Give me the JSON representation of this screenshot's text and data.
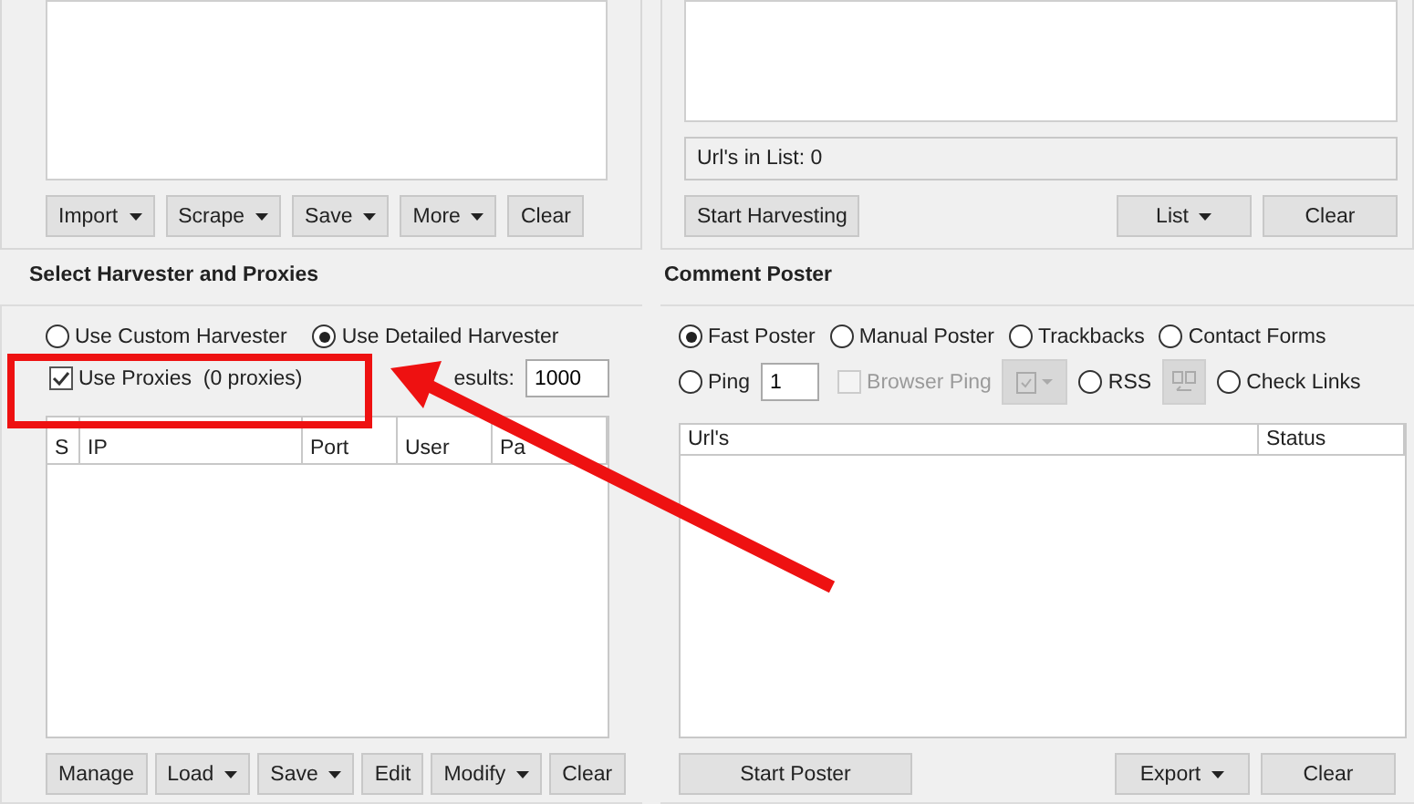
{
  "top_left": {
    "buttons": [
      {
        "label": "Import",
        "dropdown": true
      },
      {
        "label": "Scrape",
        "dropdown": true
      },
      {
        "label": "Save",
        "dropdown": true
      },
      {
        "label": "More",
        "dropdown": true
      },
      {
        "label": "Clear",
        "dropdown": false
      }
    ]
  },
  "top_right": {
    "status": "Url's in List: 0",
    "start_button": "Start Harvesting",
    "buttons": [
      {
        "label": "List",
        "dropdown": true
      },
      {
        "label": "Clear",
        "dropdown": false
      }
    ]
  },
  "harvester": {
    "title": "Select Harvester and Proxies",
    "options": [
      {
        "label": "Use Custom Harvester",
        "selected": false
      },
      {
        "label": "Use Detailed Harvester",
        "selected": true
      }
    ],
    "use_proxies": {
      "label": "Use Proxies  (0 proxies)",
      "checked": true
    },
    "results_label": "esults:",
    "results_value": "1000",
    "columns": [
      "S",
      "IP",
      "Port",
      "User",
      "Pa"
    ],
    "buttons": [
      {
        "label": "Manage",
        "dropdown": false
      },
      {
        "label": "Load",
        "dropdown": true
      },
      {
        "label": "Save",
        "dropdown": true
      },
      {
        "label": "Edit",
        "dropdown": false
      },
      {
        "label": "Modify",
        "dropdown": true
      },
      {
        "label": "Clear",
        "dropdown": false
      }
    ]
  },
  "poster": {
    "title": "Comment Poster",
    "modes": [
      {
        "label": "Fast Poster",
        "selected": true
      },
      {
        "label": "Manual Poster",
        "selected": false
      },
      {
        "label": "Trackbacks",
        "selected": false
      },
      {
        "label": "Contact Forms",
        "selected": false
      }
    ],
    "row2": [
      {
        "kind": "radio",
        "label": "Ping",
        "selected": false
      },
      {
        "kind": "input",
        "value": "1"
      },
      {
        "kind": "checkbox",
        "label": "Browser Ping",
        "checked": false,
        "disabled": true
      },
      {
        "kind": "menu",
        "disabled": true
      },
      {
        "kind": "radio",
        "label": "RSS",
        "selected": false
      },
      {
        "kind": "icon",
        "disabled": true
      },
      {
        "kind": "radio",
        "label": "Check Links",
        "selected": false
      }
    ],
    "columns": [
      "Url's",
      "Status"
    ],
    "start_button": "Start Poster",
    "buttons": [
      {
        "label": "Export",
        "dropdown": true
      },
      {
        "label": "Clear",
        "dropdown": false
      }
    ]
  }
}
